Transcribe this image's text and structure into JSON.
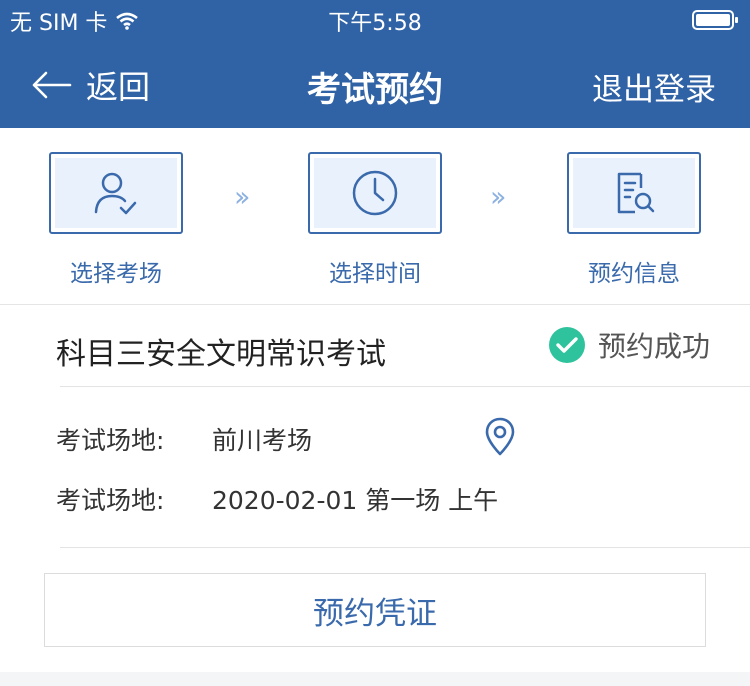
{
  "statusbar": {
    "carrier": "无 SIM 卡",
    "time": "下午5:58"
  },
  "navbar": {
    "back_label": "返回",
    "title": "考试预约",
    "logout_label": "退出登录"
  },
  "steps": [
    {
      "label": "选择考场",
      "icon": "user-check-icon"
    },
    {
      "label": "选择时间",
      "icon": "clock-icon"
    },
    {
      "label": "预约信息",
      "icon": "document-search-icon"
    }
  ],
  "exam": {
    "title": "科目三安全文明常识考试",
    "status": "预约成功",
    "status_color": "#2ec39c",
    "venue_label": "考试场地:",
    "venue_value": "前川考场",
    "time_label": "考试场地:",
    "time_value": "2020-02-01 第一场 上午"
  },
  "certificate_button": "预约凭证",
  "colors": {
    "header_bg": "#3063a6",
    "accent": "#3a6aac"
  }
}
